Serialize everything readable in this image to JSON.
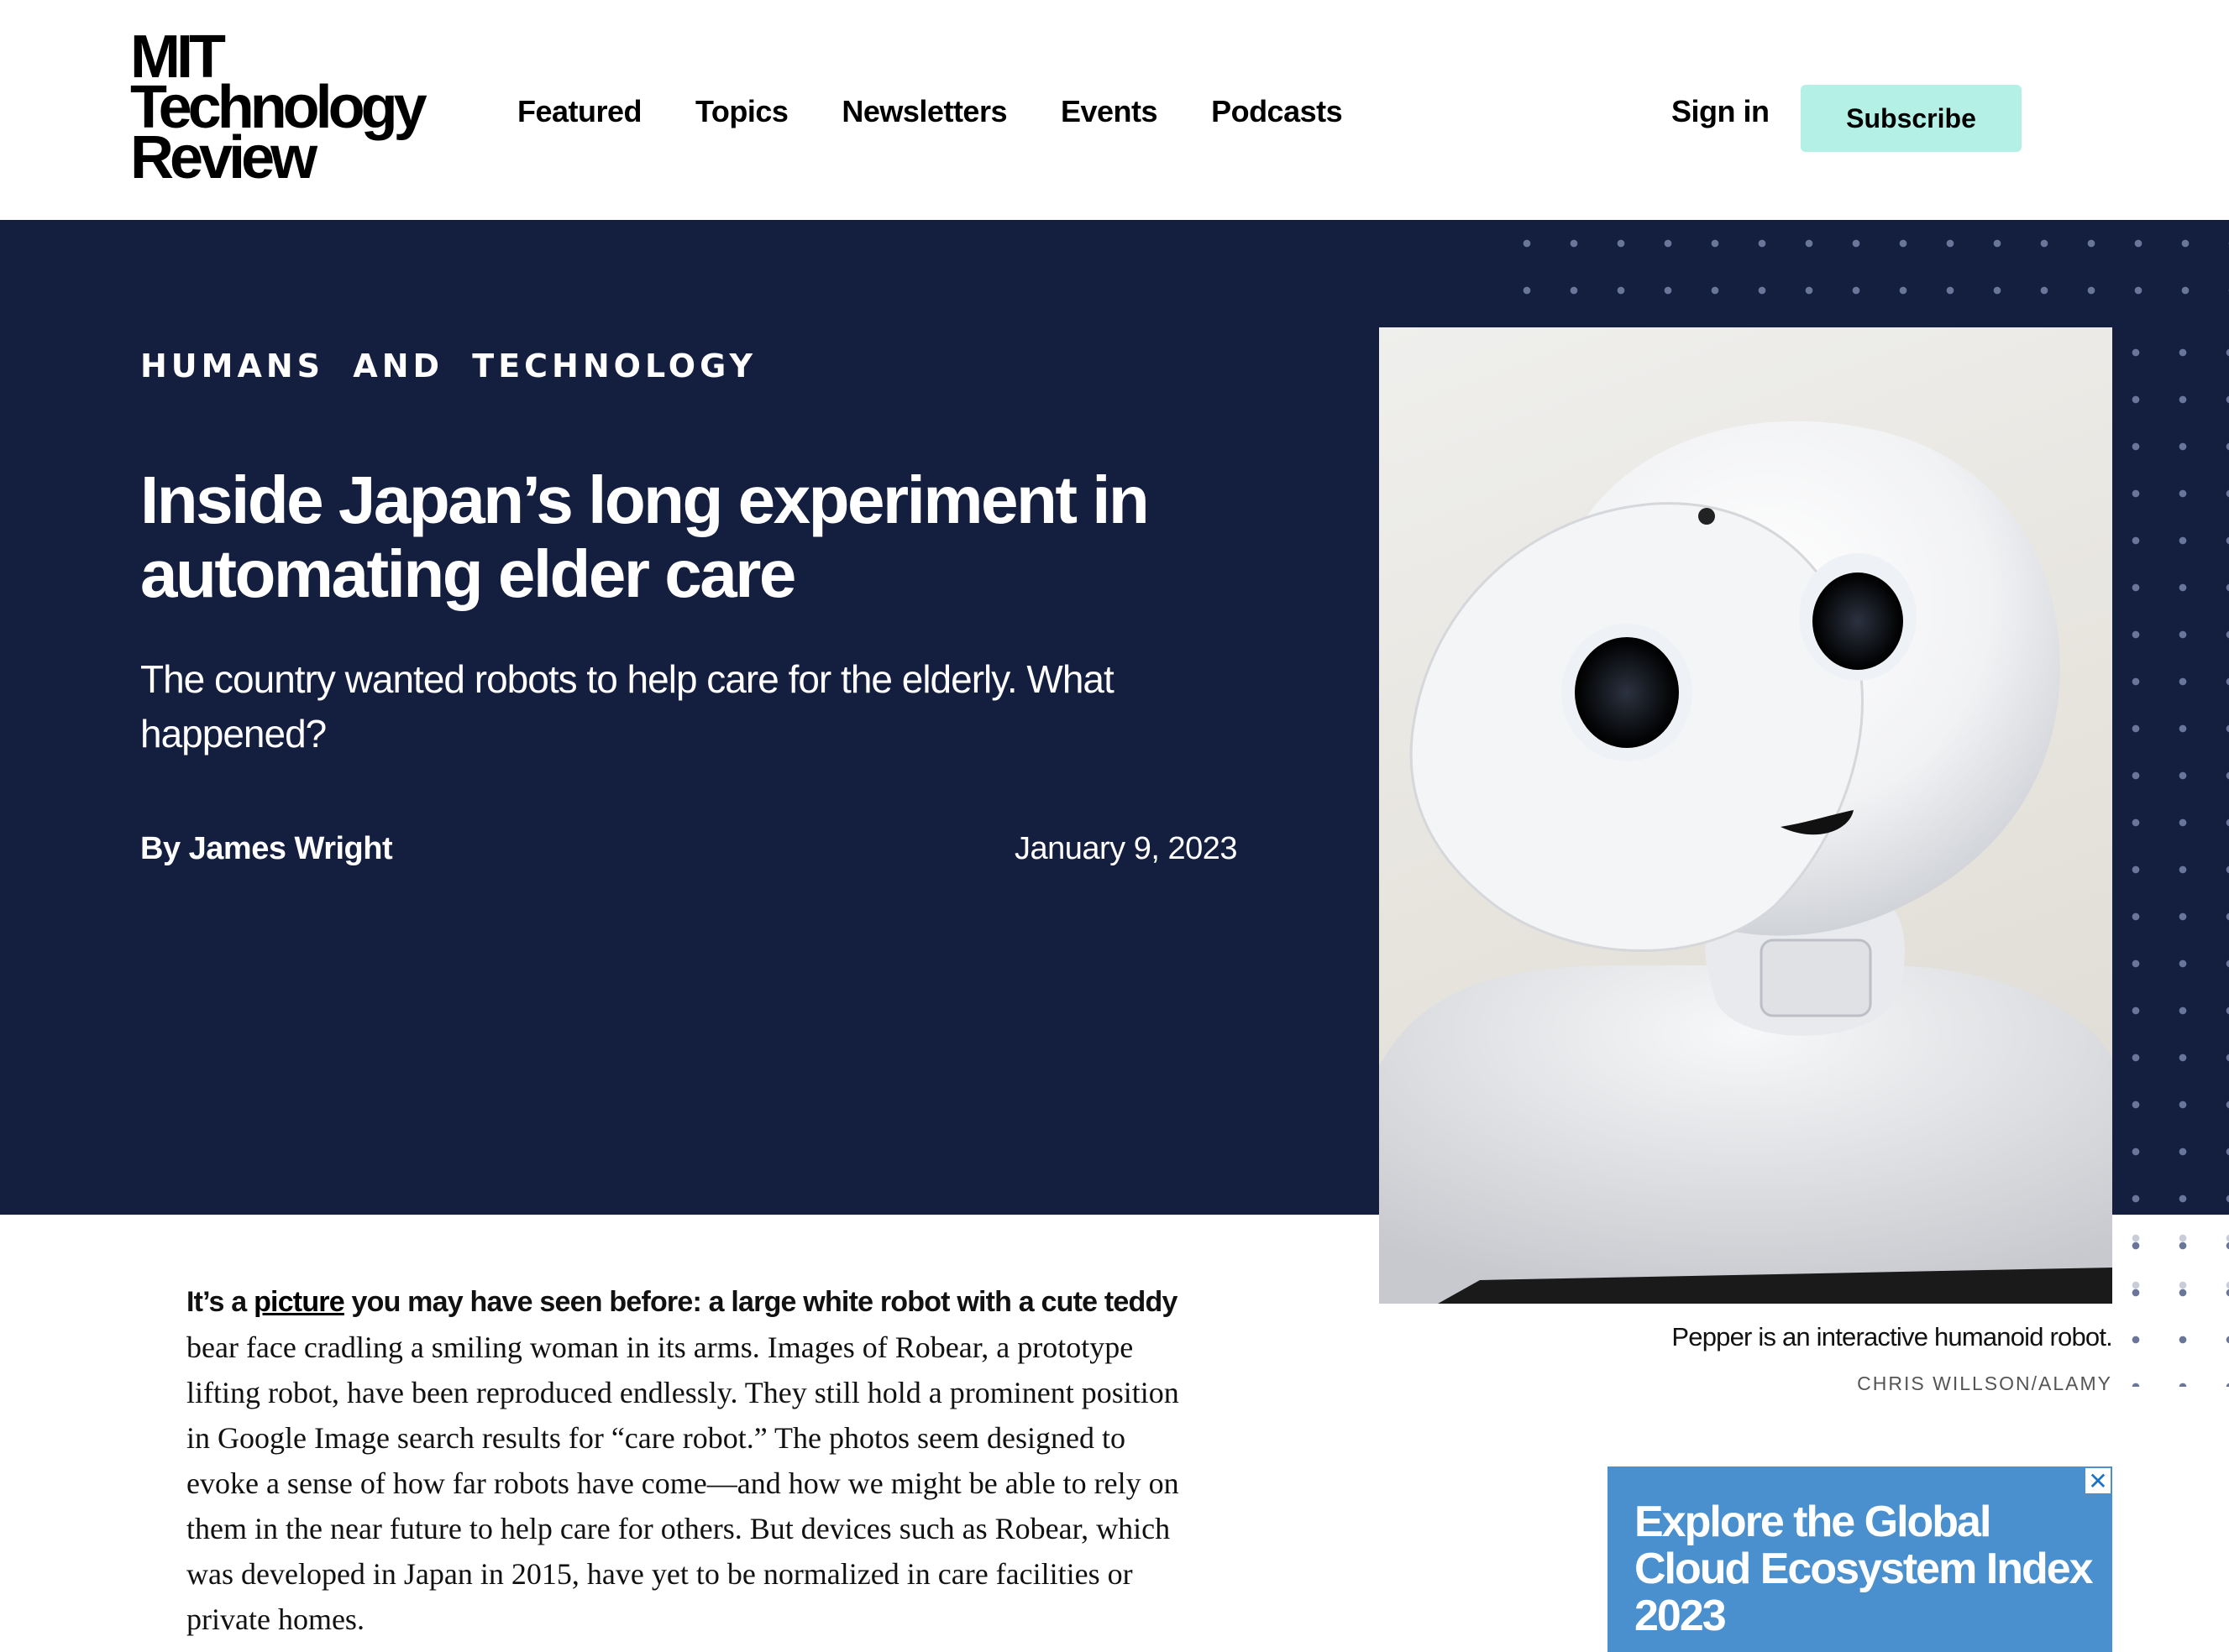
{
  "header": {
    "logo_lines": [
      "MIT",
      "Technology",
      "Review"
    ],
    "nav": [
      "Featured",
      "Topics",
      "Newsletters",
      "Events",
      "Podcasts"
    ],
    "sign_in": "Sign in",
    "subscribe": "Subscribe"
  },
  "article": {
    "topic": "HUMANS AND TECHNOLOGY",
    "title": "Inside Japan’s long experiment in automating elder care",
    "dek": "The country wanted robots to help care for the elderly. What happened?",
    "byline_prefix": "By ",
    "author": "James Wright",
    "date": "January 9, 2023",
    "image": {
      "caption": "Pepper is an interactive humanoid robot.",
      "credit": "CHRIS WILLSON/ALAMY"
    },
    "body": {
      "lead_before_link": "It’s a ",
      "lead_link": "picture",
      "lead_after_link": " you may have seen before: a large white robot with a cute teddy",
      "rest": " bear face cradling a smiling woman in its arms. Images of Robear, a prototype lifting robot, have been reproduced endlessly. They still hold a prominent position in Google Image search results for “care robot.” The photos seem designed to evoke a sense of how far robots have come—and how we might be able to rely on them in the near future to help care for others. But devices such as Robear, which was developed in Japan in 2015, have yet to be normalized in care facilities or private homes."
    }
  },
  "ad": {
    "text": "Explore the Global Cloud Ecosystem Index 2023",
    "close": "✕",
    "color": "#4a8fce"
  },
  "colors": {
    "hero_bg": "#141f40",
    "subscribe_bg": "#b4f0e6"
  }
}
